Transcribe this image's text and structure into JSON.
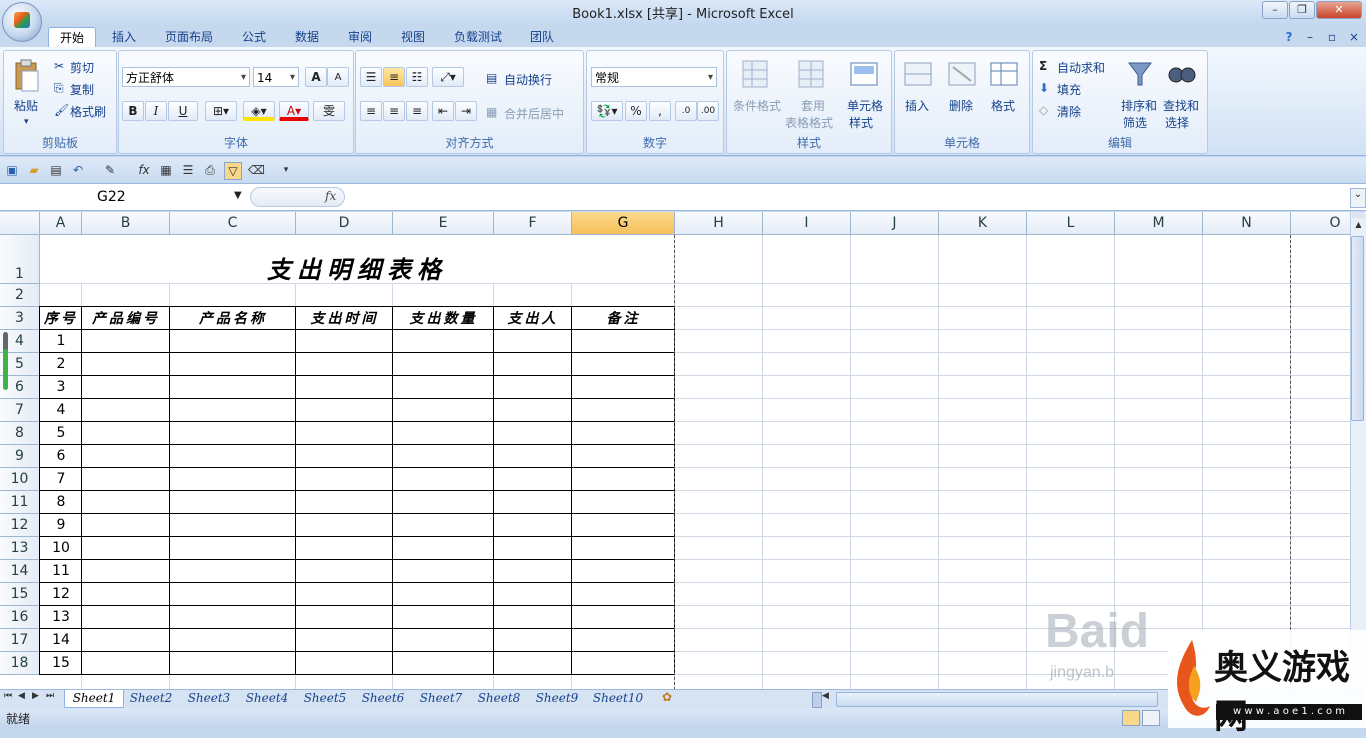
{
  "window": {
    "title": "Book1.xlsx  [共享] - Microsoft Excel"
  },
  "tabs": [
    "开始",
    "插入",
    "页面布局",
    "公式",
    "数据",
    "审阅",
    "视图",
    "负载测试",
    "团队"
  ],
  "ribbon": {
    "clipboard": {
      "paste": "粘贴",
      "cut": "剪切",
      "copy": "复制",
      "format_painter": "格式刷",
      "label": "剪贴板"
    },
    "font": {
      "name": "方正舒体",
      "size": "14",
      "label": "字体",
      "bold": "B",
      "italic": "I",
      "underline": "U",
      "grow": "A",
      "shrink": "A",
      "phonetic": "雯"
    },
    "alignment": {
      "wrap": "自动换行",
      "merge": "合并后居中",
      "label": "对齐方式"
    },
    "number": {
      "format": "常规",
      "percent": "%",
      "comma": ",",
      "label": "数字"
    },
    "styles": {
      "conditional": "条件格式",
      "table_line1": "套用",
      "table_line2": "表格格式",
      "cell_styles_line1": "单元格",
      "cell_styles_line2": "样式",
      "label": "样式"
    },
    "cells": {
      "insert": "插入",
      "delete": "删除",
      "format": "格式",
      "label": "单元格"
    },
    "editing": {
      "autosum": "自动求和",
      "fill": "填充",
      "clear": "清除",
      "sort_line1": "排序和",
      "sort_line2": "筛选",
      "find_line1": "查找和",
      "find_line2": "选择",
      "label": "编辑"
    }
  },
  "formula_bar": {
    "name_box": "G22",
    "fx": "fx",
    "value": ""
  },
  "columns": [
    "A",
    "B",
    "C",
    "D",
    "E",
    "F",
    "G",
    "H",
    "I",
    "J",
    "K",
    "L",
    "M",
    "N",
    "O"
  ],
  "selected_column": "G",
  "rows": [
    "1",
    "2",
    "3",
    "4",
    "5",
    "6",
    "7",
    "8",
    "9",
    "10",
    "11",
    "12",
    "13",
    "14",
    "15",
    "16",
    "17",
    "18"
  ],
  "sheet": {
    "title": "支出明细表格",
    "headers": [
      "序号",
      "产品编号",
      "产品名称",
      "支出时间",
      "支出数量",
      "支出人",
      "备注"
    ],
    "serials": [
      "1",
      "2",
      "3",
      "4",
      "5",
      "6",
      "7",
      "8",
      "9",
      "10",
      "11",
      "12",
      "13",
      "14",
      "15"
    ]
  },
  "sheet_tabs": [
    "Sheet1",
    "Sheet2",
    "Sheet3",
    "Sheet4",
    "Sheet5",
    "Sheet6",
    "Sheet7",
    "Sheet8",
    "Sheet9",
    "Sheet10"
  ],
  "active_sheet": "Sheet1",
  "status": {
    "mode": "就绪"
  },
  "watermarks": {
    "baidu": "Baid",
    "jingyan": "jingyan.b",
    "site_name": "奥义游戏网",
    "site_url": "w w w . a o e 1 . c o m"
  },
  "colors": {
    "selected_header": "#f6c05a",
    "ribbon_blue": "#15428b",
    "grid_line": "#d0d7e5"
  }
}
